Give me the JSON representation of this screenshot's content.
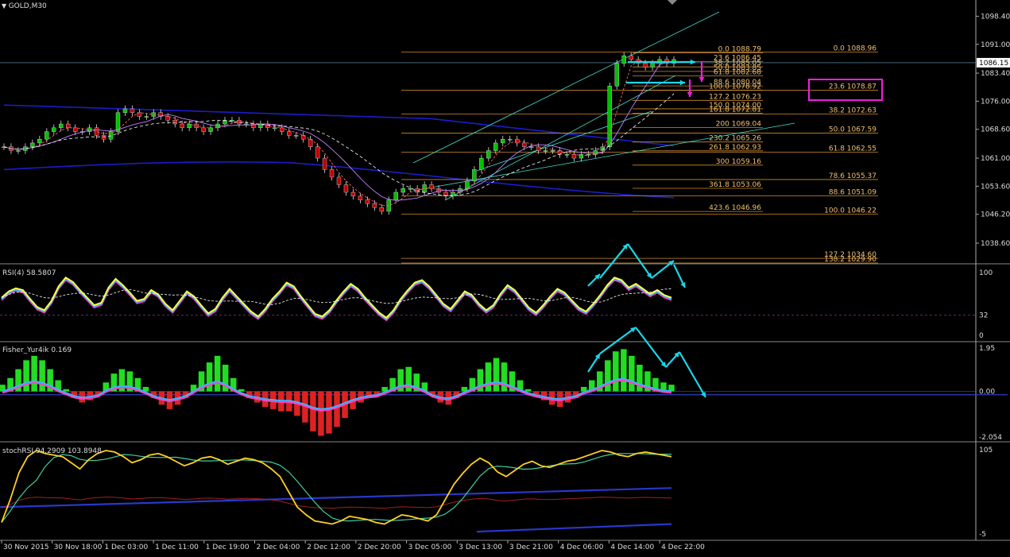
{
  "window": {
    "title": "GOLD,M30"
  },
  "colors": {
    "background": "#000000",
    "axis": "#ffffff",
    "up_candle": "#00c000",
    "down_candle": "#c00000",
    "fib": "#d08a30",
    "channel": "#40e0d0",
    "ma_blue": "#1c1cc8",
    "annotation_cyan": "#18d8e8",
    "annotation_magenta": "#f020e0",
    "rsi_yellow": "#ffff40",
    "fisher_green": "#22dd22",
    "fisher_red": "#dd2222"
  },
  "chart_data": [
    {
      "type": "line",
      "name": "GOLD,M30 price",
      "title": "GOLD,M30",
      "ylim": [
        1034,
        1101
      ],
      "current_price": "1086.15",
      "y_ticks": [
        "1098.40",
        "1091.00",
        "1083.40",
        "1076.00",
        "1068.60",
        "1061.00",
        "1053.60",
        "1046.20",
        "1038.60"
      ],
      "x_ticks": [
        "30 Nov 2015",
        "30 Nov 18:00",
        "1 Dec 03:00",
        "1 Dec 11:00",
        "1 Dec 19:00",
        "2 Dec 04:00",
        "2 Dec 12:00",
        "2 Dec 20:00",
        "3 Dec 05:00",
        "3 Dec 13:00",
        "3 Dec 21:00",
        "4 Dec 06:00",
        "4 Dec 14:00",
        "4 Dec 22:00"
      ],
      "closes": [
        1064,
        1063,
        1063,
        1064,
        1065,
        1066,
        1068,
        1069,
        1070,
        1069,
        1068,
        1068,
        1069,
        1067,
        1066,
        1068,
        1073,
        1074,
        1073,
        1072,
        1072,
        1073,
        1072,
        1071,
        1070,
        1069,
        1070,
        1069,
        1068,
        1069,
        1070,
        1071,
        1071,
        1070,
        1070,
        1069,
        1070,
        1069,
        1069,
        1068,
        1067,
        1067,
        1066,
        1064,
        1061,
        1058,
        1056,
        1054,
        1052,
        1051,
        1050,
        1049,
        1048,
        1047,
        1050,
        1052,
        1053,
        1053,
        1052,
        1054,
        1053,
        1052,
        1051,
        1052,
        1053,
        1055,
        1058,
        1061,
        1063,
        1065,
        1066,
        1066,
        1065,
        1064,
        1064,
        1063,
        1063,
        1063,
        1062,
        1062,
        1061,
        1062,
        1062,
        1063,
        1064,
        1080,
        1086,
        1088,
        1087,
        1086,
        1085,
        1086,
        1087,
        1086,
        1087
      ],
      "fib_left": [
        {
          "level": "0.0",
          "value": "1088.79"
        },
        {
          "level": "23.6",
          "value": "1086.45"
        },
        {
          "level": "38.2",
          "value": "1085.05"
        },
        {
          "level": "50.0",
          "value": "1083.85"
        },
        {
          "level": "61.8",
          "value": "1082.68"
        },
        {
          "level": "88.6",
          "value": "1080.04"
        },
        {
          "level": "100.0",
          "value": "1078.92"
        },
        {
          "level": "127.2",
          "value": "1076.23"
        },
        {
          "level": "150.0",
          "value": "1074.00"
        },
        {
          "level": "161.8",
          "value": "1072.81"
        },
        {
          "level": "200",
          "value": "1069.04"
        },
        {
          "level": "230.2",
          "value": "1065.26"
        },
        {
          "level": "261.8",
          "value": "1062.93"
        },
        {
          "level": "300",
          "value": "1059.16"
        },
        {
          "level": "361.8",
          "value": "1053.06"
        },
        {
          "level": "423.6",
          "value": "1046.96"
        }
      ],
      "fib_right": [
        {
          "level": "0.0",
          "value": "1088.96"
        },
        {
          "level": "23.6",
          "value": "1078.87"
        },
        {
          "level": "38.2",
          "value": "1072.63"
        },
        {
          "level": "50.0",
          "value": "1067.59"
        },
        {
          "level": "61.8",
          "value": "1062.55"
        },
        {
          "level": "78.6",
          "value": "1055.37"
        },
        {
          "level": "88.6",
          "value": "1051.09"
        },
        {
          "level": "100.0",
          "value": "1046.22"
        },
        {
          "level": "127.2",
          "value": "1034.60"
        },
        {
          "level": "138.2",
          "value": "1029.90"
        }
      ]
    },
    {
      "type": "line",
      "name": "RSI(4)",
      "label": "RSI(4) 58.5807",
      "ylim": [
        0,
        100
      ],
      "y_ticks": [
        "100",
        "32",
        "0"
      ],
      "values": [
        60,
        70,
        75,
        72,
        58,
        45,
        40,
        55,
        78,
        92,
        85,
        72,
        60,
        48,
        52,
        76,
        90,
        80,
        68,
        55,
        58,
        72,
        65,
        50,
        40,
        55,
        70,
        62,
        48,
        35,
        42,
        60,
        74,
        62,
        50,
        38,
        30,
        42,
        58,
        70,
        84,
        78,
        62,
        48,
        34,
        30,
        40,
        56,
        70,
        82,
        74,
        60,
        48,
        36,
        28,
        40,
        58,
        72,
        84,
        88,
        78,
        64,
        50,
        42,
        56,
        70,
        64,
        50,
        40,
        48,
        66,
        80,
        72,
        58,
        44,
        36,
        48,
        62,
        74,
        68,
        56,
        44,
        38,
        50,
        64,
        80,
        92,
        88,
        76,
        82,
        74,
        66,
        72,
        64,
        60
      ]
    },
    {
      "type": "bar",
      "name": "Fisher_Yur4ik",
      "label": "Fisher_Yur4ik 0.169",
      "ylim": [
        -2.054,
        1.95
      ],
      "y_ticks": [
        "1.95",
        "0.00",
        "-2.054"
      ],
      "values": [
        0.3,
        0.6,
        1.0,
        1.4,
        1.6,
        1.4,
        1.0,
        0.5,
        0.1,
        -0.3,
        -0.5,
        -0.4,
        -0.2,
        0.4,
        0.8,
        1.0,
        0.9,
        0.6,
        0.2,
        -0.3,
        -0.6,
        -0.8,
        -0.6,
        -0.3,
        0.3,
        0.9,
        1.3,
        1.6,
        1.2,
        0.6,
        0.1,
        -0.3,
        -0.5,
        -0.7,
        -0.8,
        -0.9,
        -0.9,
        -1.1,
        -1.4,
        -1.8,
        -2.0,
        -1.9,
        -1.6,
        -1.2,
        -0.8,
        -0.5,
        -0.3,
        -0.2,
        0.2,
        0.6,
        1.0,
        1.1,
        0.8,
        0.4,
        -0.2,
        -0.5,
        -0.6,
        -0.3,
        0.2,
        0.6,
        1.0,
        1.3,
        1.5,
        1.3,
        0.9,
        0.5,
        0.1,
        -0.2,
        -0.4,
        -0.6,
        -0.7,
        -0.5,
        -0.3,
        0.2,
        0.5,
        0.9,
        1.4,
        1.8,
        1.9,
        1.6,
        1.2,
        0.9,
        0.6,
        0.4,
        0.3
      ]
    },
    {
      "type": "line",
      "name": "stochRSI",
      "label": "stochRSI 94.2909 103.8948",
      "ylim": [
        -5,
        105
      ],
      "y_ticks": [
        "105",
        "-5"
      ],
      "values": [
        10,
        40,
        75,
        96,
        104,
        100,
        98,
        96,
        88,
        80,
        92,
        100,
        104,
        102,
        96,
        88,
        92,
        98,
        100,
        96,
        90,
        84,
        88,
        94,
        96,
        92,
        86,
        90,
        94,
        92,
        88,
        80,
        70,
        50,
        30,
        20,
        12,
        10,
        8,
        12,
        18,
        16,
        14,
        10,
        8,
        14,
        20,
        18,
        15,
        12,
        20,
        40,
        60,
        74,
        86,
        94,
        88,
        76,
        70,
        78,
        86,
        90,
        84,
        82,
        86,
        90,
        92,
        96,
        100,
        104,
        102,
        98,
        96,
        100,
        102,
        100,
        98,
        96
      ]
    }
  ],
  "annotations": {
    "highlight_box": "23.6  1078.87"
  }
}
